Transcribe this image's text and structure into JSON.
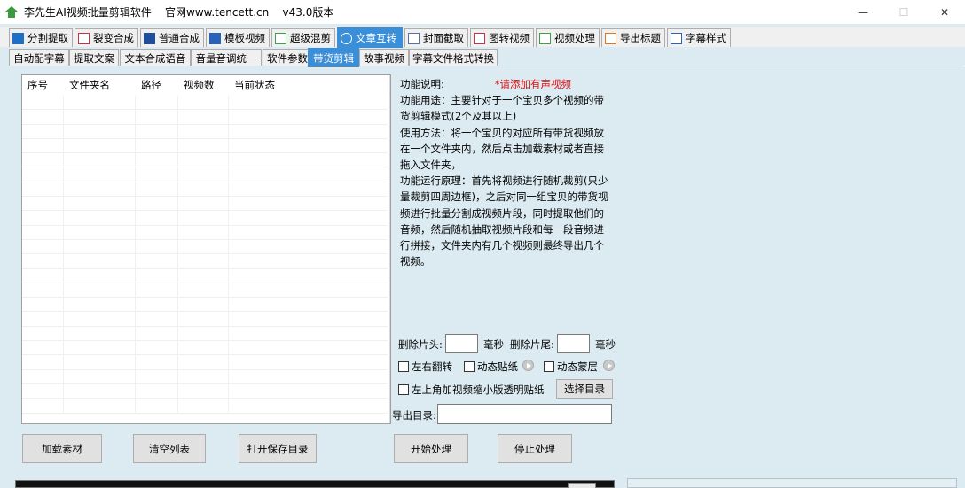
{
  "window": {
    "title": "李先生AI视频批量剪辑软件    官网www.tencett.cn    v43.0版本",
    "minimize_glyph": "—",
    "maximize_glyph": "☐",
    "close_glyph": "✕"
  },
  "top_tabs": [
    {
      "label": "分割提取",
      "icon": "play-square-icon",
      "color": "#1f6fc4"
    },
    {
      "label": "裂变合成",
      "icon": "copy-icon",
      "color": "#c8304a"
    },
    {
      "label": "普通合成",
      "icon": "play-icon",
      "color": "#1f4f9c"
    },
    {
      "label": "模板视频",
      "icon": "bookmark-icon",
      "color": "#2a62b8"
    },
    {
      "label": "超级混剪",
      "icon": "waveform-icon",
      "color": "#3aa04a"
    },
    {
      "label": "文章互转",
      "icon": "bulb-icon",
      "color": "#ffffff",
      "active": true
    },
    {
      "label": "封面截取",
      "icon": "image-icon",
      "color": "#5a6fa8"
    },
    {
      "label": "图转视频",
      "icon": "picture-play-icon",
      "color": "#c8304a"
    },
    {
      "label": "视频处理",
      "icon": "film-icon",
      "color": "#3aa04a"
    },
    {
      "label": "导出标题",
      "icon": "export-icon",
      "color": "#d97a20"
    },
    {
      "label": "字幕样式",
      "icon": "document-icon",
      "color": "#2a62b8"
    }
  ],
  "sub_tabs": [
    {
      "label": "自动配字幕"
    },
    {
      "label": "提取文案"
    },
    {
      "label": "文本合成语音"
    },
    {
      "label": "音量音调统一"
    },
    {
      "label": "软件参数"
    },
    {
      "label": "带货剪辑",
      "active": true
    },
    {
      "label": "故事视频"
    },
    {
      "label": "字幕文件格式转换"
    }
  ],
  "table": {
    "columns": [
      "序号",
      "文件夹名",
      "路径",
      "视频数",
      "当前状态"
    ],
    "rows": []
  },
  "info": {
    "heading": "功能说明:",
    "note": "*请添加有声视频",
    "paragraphs": [
      "功能用途：主要针对于一个宝贝多个视频的带货剪辑模式(2个及其以上)",
      "使用方法：将一个宝贝的对应所有带货视频放在一个文件夹内，然后点击加载素材或者直接拖入文件夹，",
      "功能运行原理：首先将视频进行随机裁剪(只少量裁剪四周边框)，之后对同一组宝贝的带货视频进行批量分割成视频片段，同时提取他们的音频，然后随机抽取视频片段和每一段音频进行拼接，文件夹内有几个视频则最终导出几个视频。"
    ]
  },
  "controls": {
    "trim_head_label": "删除片头:",
    "trim_head_value": "",
    "trim_head_unit": "毫秒",
    "trim_tail_label": "删除片尾:",
    "trim_tail_value": "",
    "trim_tail_unit": "毫秒",
    "flip_label": "左右翻转",
    "sticker_label": "动态贴纸",
    "mask_label": "动态蒙层",
    "pip_label": "左上角加视频缩小版透明贴纸",
    "select_dir_button": "选择目录",
    "export_dir_label": "导出目录:",
    "export_dir_value": ""
  },
  "buttons": {
    "load": "加载素材",
    "clear": "清空列表",
    "open_save_dir": "打开保存目录",
    "start": "开始处理",
    "stop": "停止处理"
  }
}
